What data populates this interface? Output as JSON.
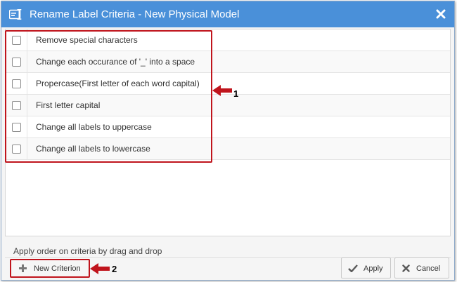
{
  "dialog": {
    "title": "Rename Label Criteria - New Physical Model",
    "title_icon": "rename-label-icon",
    "close_icon": "close-icon"
  },
  "criteria": [
    {
      "label": "Remove special characters",
      "checked": false
    },
    {
      "label": "Change each occurance of '_' into a space",
      "checked": false
    },
    {
      "label": "Propercase(First letter of each word capital)",
      "checked": false
    },
    {
      "label": "First letter capital",
      "checked": false
    },
    {
      "label": "Change all labels to uppercase",
      "checked": false
    },
    {
      "label": "Change all labels to lowercase",
      "checked": false
    }
  ],
  "annotations": {
    "callout_1": "1",
    "callout_2": "2",
    "accent_color": "#c0141c"
  },
  "footer": {
    "hint": "Apply order on criteria by drag and drop",
    "new_criterion_label": "New Criterion",
    "apply_label": "Apply",
    "cancel_label": "Cancel"
  },
  "colors": {
    "titlebar": "#4a90d9",
    "checkmark": "#5a5a5a"
  }
}
